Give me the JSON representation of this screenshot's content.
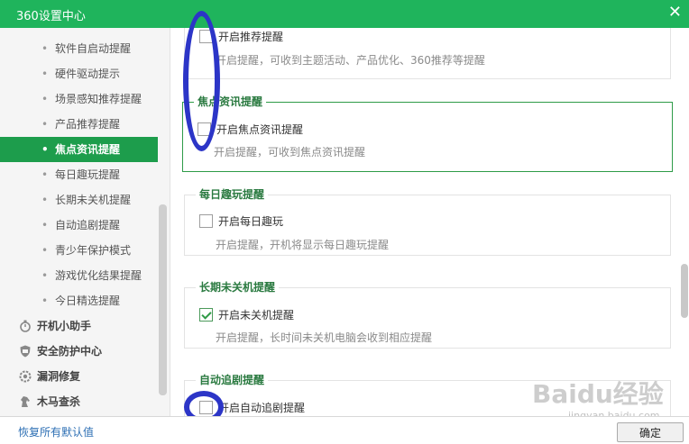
{
  "window": {
    "title": "360设置中心",
    "close_glyph": "✕"
  },
  "sidebar": {
    "sub_items": [
      {
        "label": "软件自启动提醒",
        "active": false
      },
      {
        "label": "硬件驱动提示",
        "active": false
      },
      {
        "label": "场景感知推荐提醒",
        "active": false
      },
      {
        "label": "产品推荐提醒",
        "active": false
      },
      {
        "label": "焦点资讯提醒",
        "active": true
      },
      {
        "label": "每日趣玩提醒",
        "active": false
      },
      {
        "label": "长期未关机提醒",
        "active": false
      },
      {
        "label": "自动追剧提醒",
        "active": false
      },
      {
        "label": "青少年保护模式",
        "active": false
      },
      {
        "label": "游戏优化结果提醒",
        "active": false
      },
      {
        "label": "今日精选提醒",
        "active": false
      }
    ],
    "bullet": "•",
    "main_items": [
      {
        "label": "开机小助手",
        "icon": "stopwatch-icon"
      },
      {
        "label": "安全防护中心",
        "icon": "shield-icon"
      },
      {
        "label": "漏洞修复",
        "icon": "gear-icon"
      },
      {
        "label": "木马查杀",
        "icon": "horse-icon"
      }
    ]
  },
  "sections": [
    {
      "legend": "",
      "checkbox_label": "开启推荐提醒",
      "checked": false,
      "description": "开启提醒，可收到主题活动、产品优化、360推荐等提醒"
    },
    {
      "legend": "焦点资讯提醒",
      "checkbox_label": "开启焦点资讯提醒",
      "checked": false,
      "description": "开启提醒，可收到焦点资讯提醒"
    },
    {
      "legend": "每日趣玩提醒",
      "checkbox_label": "开启每日趣玩",
      "checked": false,
      "description": "开启提醒，开机将显示每日趣玩提醒"
    },
    {
      "legend": "长期未关机提醒",
      "checkbox_label": "开启未关机提醒",
      "checked": true,
      "description": "开启提醒，长时间未关机电脑会收到相应提醒"
    },
    {
      "legend": "自动追剧提醒",
      "checkbox_label": "开启自动追剧提醒",
      "checked": false,
      "description": ""
    }
  ],
  "footer": {
    "restore_label": "恢复所有默认值",
    "ok_label": "确定"
  },
  "watermark": {
    "main": "Baidu经验",
    "sub": "jingyan.baidu.com"
  },
  "colors": {
    "titlebar": "#1fb45c",
    "active_item": "#1d9d4c",
    "focus_border": "#2e9b48",
    "annotation": "#2c35c7"
  }
}
